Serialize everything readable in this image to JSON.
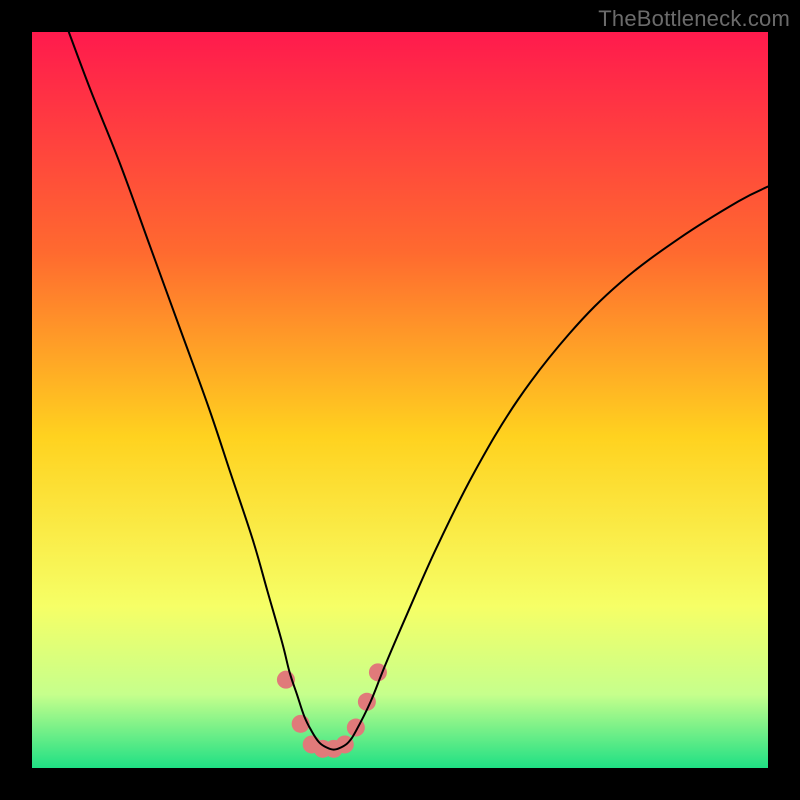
{
  "watermark": "TheBottleneck.com",
  "chart_data": {
    "type": "line",
    "title": "",
    "xlabel": "",
    "ylabel": "",
    "xlim": [
      0,
      100
    ],
    "ylim": [
      0,
      100
    ],
    "background_gradient": {
      "stops": [
        {
          "offset": 0.0,
          "color": "#ff1a4d"
        },
        {
          "offset": 0.3,
          "color": "#ff6a2f"
        },
        {
          "offset": 0.55,
          "color": "#ffd21f"
        },
        {
          "offset": 0.78,
          "color": "#f6ff66"
        },
        {
          "offset": 0.9,
          "color": "#c6ff8c"
        },
        {
          "offset": 1.0,
          "color": "#1fe084"
        }
      ]
    },
    "series": [
      {
        "name": "bottleneck-curve",
        "color": "#000000",
        "stroke_width": 2,
        "x": [
          5,
          8,
          12,
          16,
          20,
          24,
          27,
          30,
          32,
          34,
          35,
          36,
          37,
          38,
          39,
          40,
          41,
          42,
          43,
          44,
          46,
          48,
          51,
          55,
          60,
          66,
          73,
          80,
          88,
          96,
          100
        ],
        "y": [
          100,
          92,
          82,
          71,
          60,
          49,
          40,
          31,
          24,
          17,
          13,
          10,
          7,
          5,
          3.5,
          2.8,
          2.5,
          2.8,
          3.5,
          5,
          9,
          14,
          21,
          30,
          40,
          50,
          59,
          66,
          72,
          77,
          79
        ]
      }
    ],
    "markers": {
      "name": "highlight-band",
      "color": "#e07a7a",
      "radius": 9,
      "points": [
        {
          "x": 34.5,
          "y": 12
        },
        {
          "x": 36.5,
          "y": 6
        },
        {
          "x": 38,
          "y": 3.2
        },
        {
          "x": 39.5,
          "y": 2.6
        },
        {
          "x": 41,
          "y": 2.6
        },
        {
          "x": 42.5,
          "y": 3.2
        },
        {
          "x": 44,
          "y": 5.5
        },
        {
          "x": 45.5,
          "y": 9
        },
        {
          "x": 47,
          "y": 13
        }
      ]
    }
  }
}
